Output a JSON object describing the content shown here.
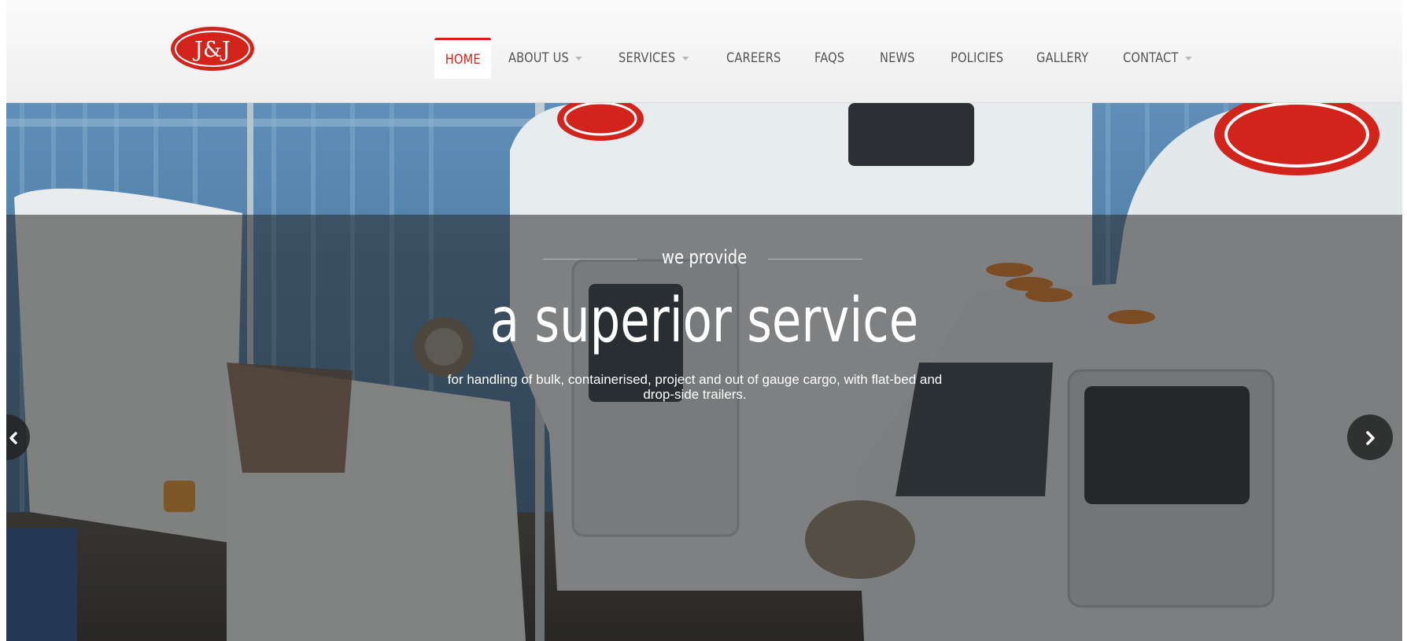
{
  "brand": {
    "logo_text": "J&J",
    "accent": "#d3241c"
  },
  "nav": {
    "items": [
      {
        "label": "HOME",
        "active": true,
        "has_dropdown": false
      },
      {
        "label": "ABOUT US",
        "active": false,
        "has_dropdown": true
      },
      {
        "label": "SERVICES",
        "active": false,
        "has_dropdown": true
      },
      {
        "label": "CAREERS",
        "active": false,
        "has_dropdown": false
      },
      {
        "label": "FAQS",
        "active": false,
        "has_dropdown": false
      },
      {
        "label": "NEWS",
        "active": false,
        "has_dropdown": false
      },
      {
        "label": "POLICIES",
        "active": false,
        "has_dropdown": false
      },
      {
        "label": "GALLERY",
        "active": false,
        "has_dropdown": false
      },
      {
        "label": "CONTACT",
        "active": false,
        "has_dropdown": true
      }
    ]
  },
  "hero": {
    "kicker": "we provide",
    "headline": "a superior service",
    "subtitle_line1": "for handling of bulk, containerised, project and out of gauge cargo, with flat-bed and",
    "subtitle_line2": "drop-side trailers.",
    "prev_icon": "chevron-left-icon",
    "next_icon": "chevron-right-icon"
  }
}
